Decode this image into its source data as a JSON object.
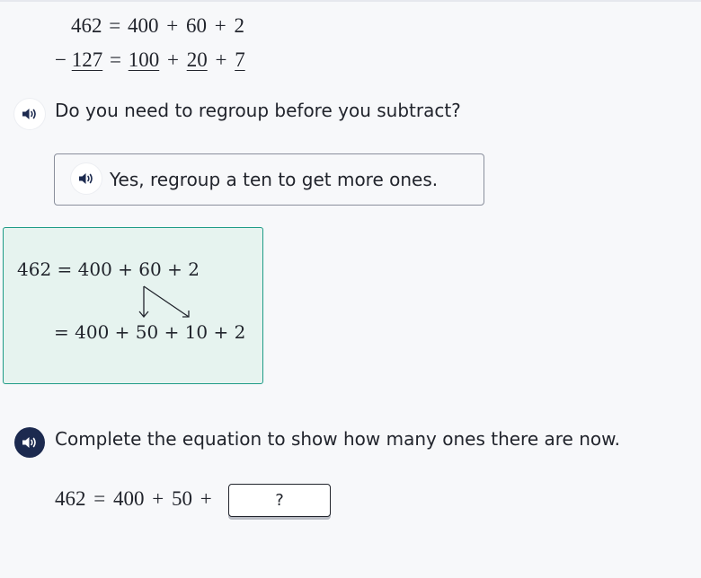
{
  "problem": {
    "line1": {
      "left": "462",
      "eq": "=",
      "t1": "400",
      "p1": "+",
      "t2": "60",
      "p2": "+",
      "t3": "2"
    },
    "line2": {
      "minus": "−",
      "left": "127",
      "eq": "=",
      "t1": "100",
      "p1": "+",
      "t2": "20",
      "p2": "+",
      "t3": "7"
    }
  },
  "question1": {
    "text": "Do you need to regroup before you subtract?",
    "speaker_icon": "speaker-icon"
  },
  "answer1": {
    "text": "Yes, regroup a ten to get more ones.",
    "speaker_icon": "speaker-icon"
  },
  "hint": {
    "line1": "462 = 400 + 60 + 2",
    "line2": "= 400 + 50 + 10 + 2"
  },
  "question2": {
    "text": "Complete the equation to show how many ones there are now.",
    "speaker_icon": "speaker-icon"
  },
  "equation2": {
    "left": "462",
    "eq": "=",
    "t1": "400",
    "p1": "+",
    "t2": "50",
    "p2": "+",
    "input_placeholder": "?"
  },
  "colors": {
    "hint_border": "#1f9c87",
    "hint_bg": "#e6f3ef",
    "speaker_dark": "#1c2a4f"
  }
}
